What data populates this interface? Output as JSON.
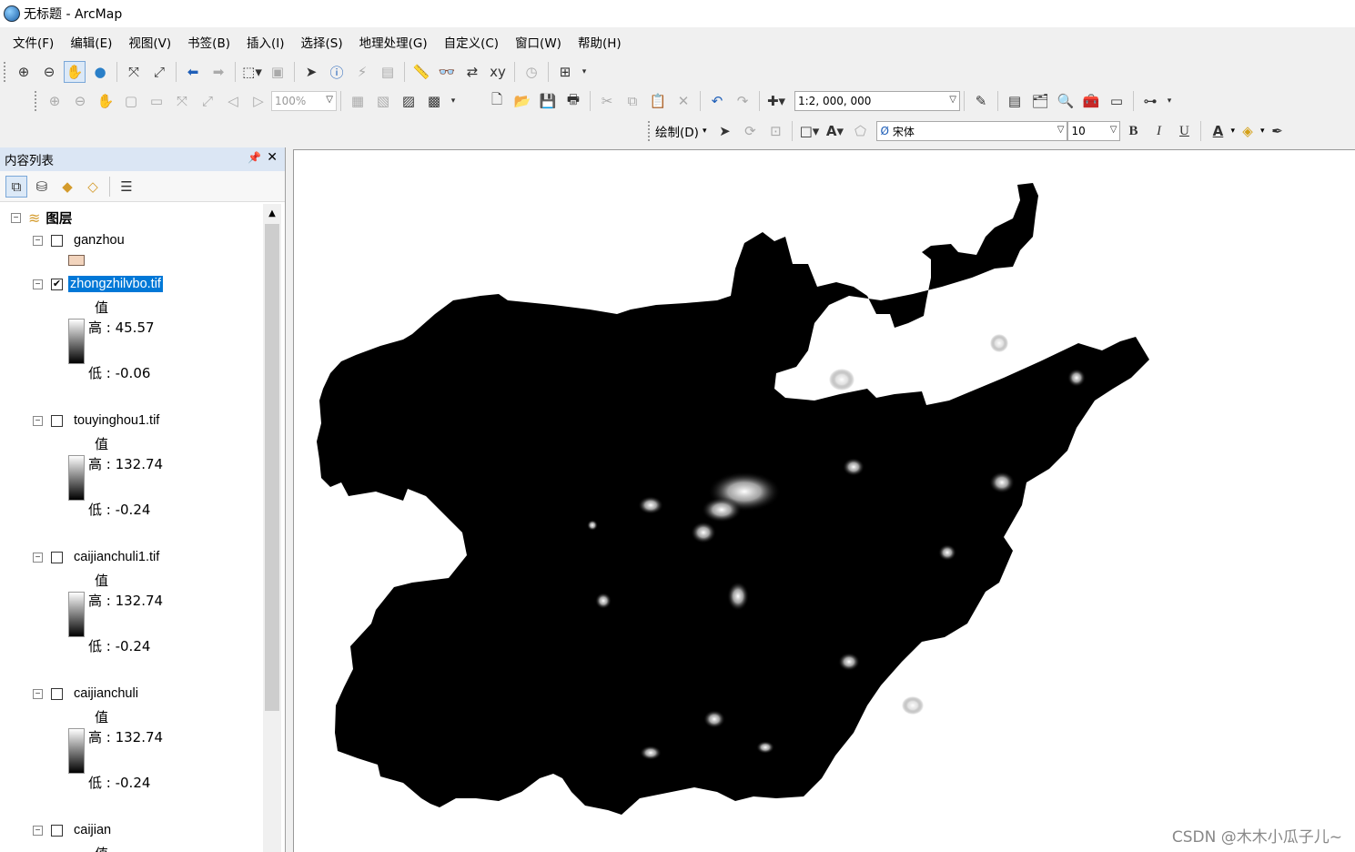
{
  "window": {
    "title": "无标题 - ArcMap"
  },
  "menu": [
    "文件(F)",
    "编辑(E)",
    "视图(V)",
    "书签(B)",
    "插入(I)",
    "选择(S)",
    "地理处理(G)",
    "自定义(C)",
    "窗口(W)",
    "帮助(H)"
  ],
  "toolbar": {
    "layout_zoom": "100%",
    "scale": "1:2, 000, 000",
    "draw_label": "绘制(D)",
    "font_name": "宋体",
    "font_size": "10",
    "bold": "B",
    "italic": "I",
    "underline": "U",
    "font_color_letter": "A"
  },
  "toc": {
    "title": "内容列表",
    "root_label": "图层",
    "layers": [
      {
        "name": "ganzhou",
        "checked": false
      },
      {
        "name": "zhongzhilvbo.tif",
        "checked": true,
        "selected": true,
        "field": "值",
        "high": "高 : 45.57",
        "low": "低 : -0.06"
      },
      {
        "name": "touyinghou1.tif",
        "checked": false,
        "field": "值",
        "high": "高 : 132.74",
        "low": "低 : -0.24"
      },
      {
        "name": "caijianchuli1.tif",
        "checked": false,
        "field": "值",
        "high": "高 : 132.74",
        "low": "低 : -0.24"
      },
      {
        "name": "caijianchuli",
        "checked": false,
        "field": "值",
        "high": "高 : 132.74",
        "low": "低 : -0.24"
      },
      {
        "name": "caijian",
        "checked": false,
        "field": "值"
      }
    ]
  },
  "watermark": "CSDN @木木小瓜子儿~",
  "colors": {
    "selection": "#0078d7",
    "toc_header": "#dbe6f4",
    "polygon_fill": "#f2d4bd",
    "raster": "#000000"
  }
}
